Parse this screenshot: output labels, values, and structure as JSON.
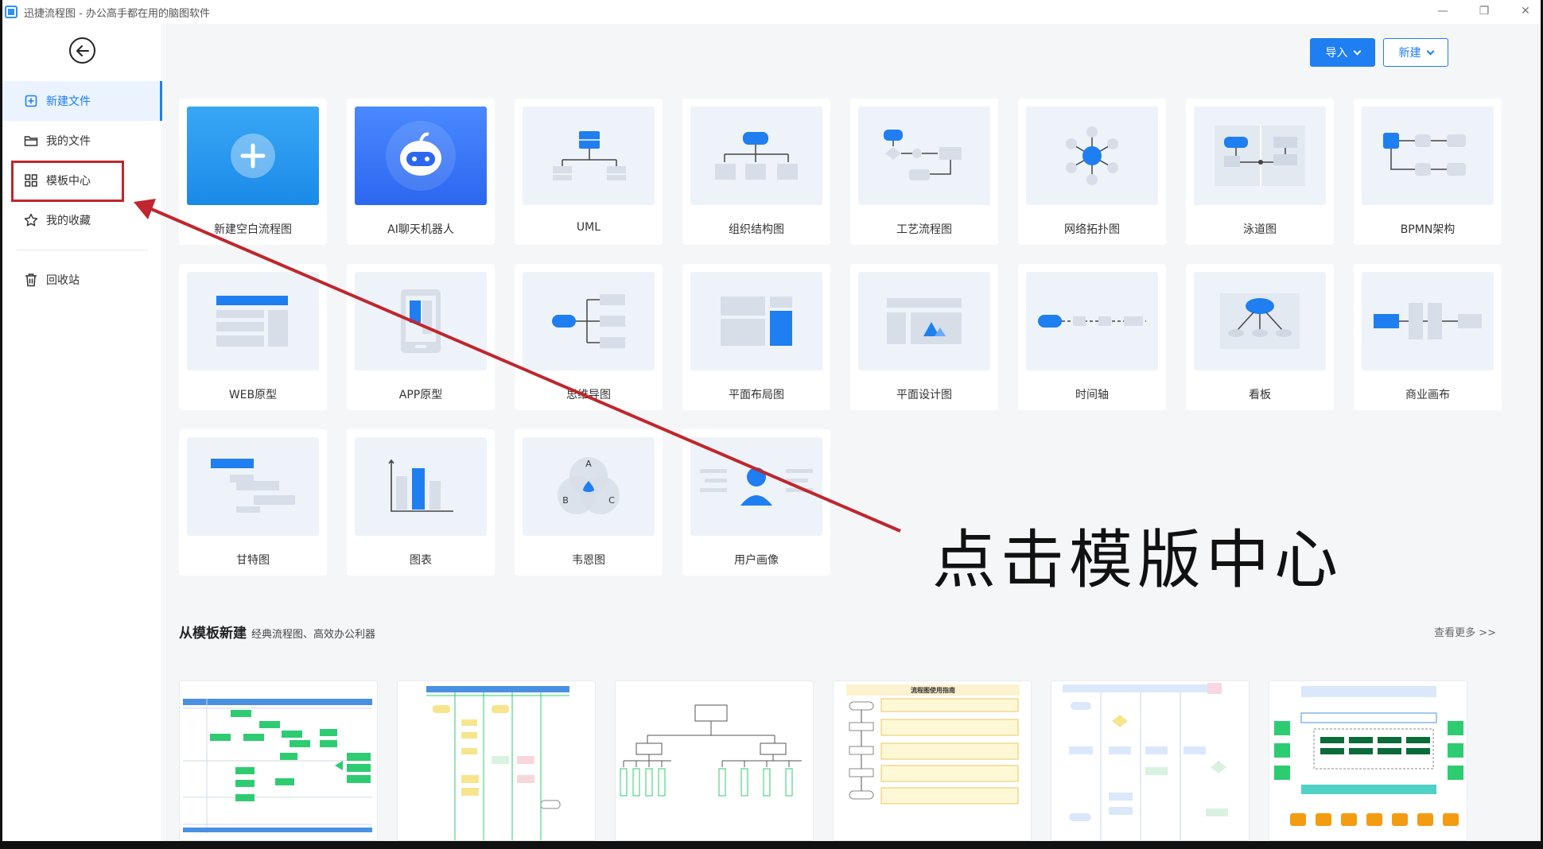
{
  "window": {
    "title": "迅捷流程图 - 办公高手都在用的脑图软件",
    "controls": [
      "—",
      "❐",
      "✕"
    ]
  },
  "sidebar": {
    "items": [
      {
        "label": "新建文件",
        "icon": "add-file-icon",
        "active": true
      },
      {
        "label": "我的文件",
        "icon": "folder-icon",
        "active": false
      },
      {
        "label": "模板中心",
        "icon": "grid-icon",
        "active": false
      },
      {
        "label": "我的收藏",
        "icon": "star-icon",
        "active": false
      },
      {
        "label": "回收站",
        "icon": "trash-icon",
        "active": false
      }
    ]
  },
  "header": {
    "import_label": "导入",
    "new_label": "新建"
  },
  "cards": [
    {
      "label": "新建空白流程图",
      "icon": "plus-icon"
    },
    {
      "label": "AI聊天机器人",
      "icon": "robot-icon"
    },
    {
      "label": "UML",
      "icon": "uml-icon"
    },
    {
      "label": "组织结构图",
      "icon": "org-chart-icon"
    },
    {
      "label": "工艺流程图",
      "icon": "process-flow-icon"
    },
    {
      "label": "网络拓扑图",
      "icon": "network-topology-icon"
    },
    {
      "label": "泳道图",
      "icon": "swimlane-icon"
    },
    {
      "label": "BPMN架构",
      "icon": "bpmn-icon"
    },
    {
      "label": "WEB原型",
      "icon": "web-prototype-icon"
    },
    {
      "label": "APP原型",
      "icon": "app-prototype-icon"
    },
    {
      "label": "思维导图",
      "icon": "mindmap-icon"
    },
    {
      "label": "平面布局图",
      "icon": "floor-plan-icon"
    },
    {
      "label": "平面设计图",
      "icon": "graphic-design-icon"
    },
    {
      "label": "时间轴",
      "icon": "timeline-icon"
    },
    {
      "label": "看板",
      "icon": "kanban-icon"
    },
    {
      "label": "商业画布",
      "icon": "business-canvas-icon"
    },
    {
      "label": "甘特图",
      "icon": "gantt-icon"
    },
    {
      "label": "图表",
      "icon": "chart-icon"
    },
    {
      "label": "韦恩图",
      "icon": "venn-icon"
    },
    {
      "label": "用户画像",
      "icon": "user-persona-icon"
    }
  ],
  "venn_letters": [
    "A",
    "B",
    "C"
  ],
  "templates_section": {
    "title": "从模板新建",
    "subtitle": "经典流程图、高效办公利器",
    "see_more": "查看更多 >>"
  },
  "templates": [
    {
      "name": "template-1"
    },
    {
      "name": "template-2"
    },
    {
      "name": "template-3"
    },
    {
      "name": "template-4",
      "heading": "流程图使用指南"
    },
    {
      "name": "template-5"
    },
    {
      "name": "template-6"
    }
  ],
  "annotation": {
    "callout_text": "点击模版中心",
    "color": "#c0262d"
  },
  "colors": {
    "accent": "#1f7ef0",
    "highlight": "#c0262d"
  }
}
